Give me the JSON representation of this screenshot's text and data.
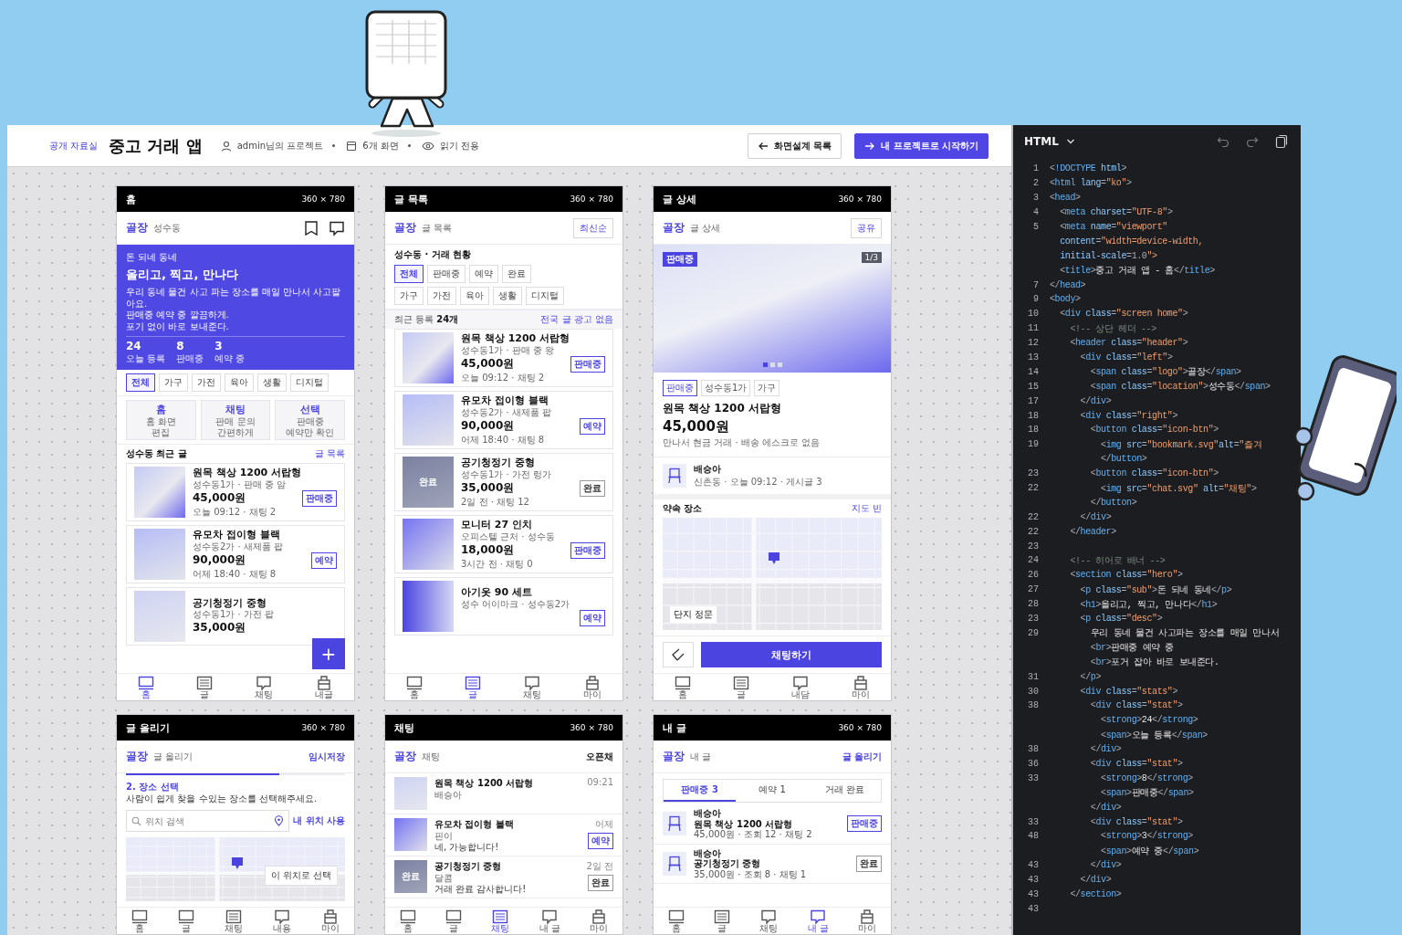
{
  "topbar": {
    "breadcrumb": "공개 자료실",
    "title": "중고 거래 앱",
    "meta": [
      "admin님의 프로젝트",
      "6개 화면",
      "읽기 전용"
    ],
    "buttons": [
      {
        "kind": "secondary",
        "label": "화면설계 목록"
      },
      {
        "kind": "primary",
        "label": "내 프로젝트로 시작하기"
      }
    ]
  },
  "screens": [
    {
      "title": "홈",
      "size": "360 × 780",
      "header": {
        "logo": "골장",
        "subtitle": "성수동",
        "actions": [
          {
            "kind": "bookmark"
          },
          {
            "kind": "chat"
          }
        ]
      },
      "sections": [
        {
          "kind": "hero",
          "eyebrow": "돈 되네 동네",
          "title": "올리고, 찍고, 만나다",
          "desc": [
            "우리 동네 물건 사고 파는 장소를 매일 만나서 사고팔아요.",
            "판매중 예약 중 깔끔하게.",
            "포기 없이 바로 보내준다."
          ],
          "stats": [
            {
              "value": "24",
              "label": "오늘 등록"
            },
            {
              "value": "8",
              "label": "판매중"
            },
            {
              "value": "3",
              "label": "예약 중"
            }
          ]
        },
        {
          "kind": "chips",
          "rows": [
            [
              {
                "label": "전체",
                "selected": true
              },
              {
                "label": "가구",
                "selected": false
              },
              {
                "label": "가전",
                "selected": false
              },
              {
                "label": "육아",
                "selected": false
              },
              {
                "label": "생활",
                "selected": false
              },
              {
                "label": "디지털",
                "selected": false
              }
            ]
          ]
        },
        {
          "kind": "shortcuts",
          "items": [
            {
              "title": "홈",
              "lines": [
                "홈 화면",
                "편집"
              ]
            },
            {
              "title": "채팅",
              "lines": [
                "판매 문의",
                "간편하게"
              ]
            },
            {
              "title": "선택",
              "lines": [
                "판매중",
                "예약만 확인"
              ]
            }
          ]
        },
        {
          "kind": "heading",
          "title": "성수동 최근 글",
          "link": "글 목록"
        },
        {
          "kind": "listings",
          "items": [
            {
              "title": "원목 책상 1200 서랍형",
              "meta": "성수동1가 · 판매 중 암",
              "price": "45,000원",
              "time": "오늘 09:12 · 채팅 2",
              "badge": {
                "label": "판매중",
                "kind": "sale"
              }
            },
            {
              "title": "유모차 접이형 블랙",
              "meta": "성수동2가 · 새제품 팝",
              "price": "90,000원",
              "time": "어제 18:40 · 채팅 8",
              "badge": {
                "label": "예약",
                "kind": "reserved"
              }
            },
            {
              "title": "공기청정기 중형",
              "meta": "성수동1가 · 가전 팝",
              "price": "35,000원"
            }
          ]
        }
      ],
      "fab": "+",
      "nav": [
        {
          "label": "홈",
          "kind": "monitor",
          "selected": true
        },
        {
          "label": "글",
          "kind": "list",
          "selected": false
        },
        {
          "label": "채팅",
          "kind": "chat",
          "selected": false
        },
        {
          "label": "내글",
          "kind": "bag",
          "selected": false
        }
      ]
    },
    {
      "title": "글 목록",
      "size": "360 × 780",
      "header": {
        "logo": "골장",
        "subtitle": "글 목록",
        "actions": [
          {
            "kind": "button",
            "label": "최신순"
          }
        ]
      },
      "sections": [
        {
          "kind": "chips",
          "title": "성수동 · 거래 현황",
          "rows": [
            [
              {
                "label": "전체",
                "selected": true
              },
              {
                "label": "판매중",
                "selected": false
              },
              {
                "label": "예약",
                "selected": false
              },
              {
                "label": "완료",
                "selected": false
              }
            ],
            [
              {
                "label": "가구",
                "selected": false
              },
              {
                "label": "가전",
                "selected": false
              },
              {
                "label": "육아",
                "selected": false
              },
              {
                "label": "생활",
                "selected": false
              },
              {
                "label": "디지털",
                "selected": false
              }
            ]
          ]
        },
        {
          "kind": "count",
          "text": "최근 등록 **24개**",
          "link": "전국 글 광고 없음"
        },
        {
          "kind": "listings",
          "items": [
            {
              "title": "원목 책상 1200 서랍형",
              "meta": "성수동1가 · 판매 중 왕",
              "price": "45,000원",
              "time": "오늘 09:12 · 채팅 2",
              "badge": {
                "label": "판매중",
                "kind": "sale"
              }
            },
            {
              "title": "유모차 접이형 블랙",
              "meta": "성수동2가 · 새제품 팝",
              "price": "90,000원",
              "time": "어제 18:40 · 채팅 8",
              "badge": {
                "label": "예약",
                "kind": "reserved"
              }
            },
            {
              "thumb_label": "완료",
              "title": "공기청정기 중형",
              "meta": "성수동1가 · 가전 렁가",
              "price": "35,000원",
              "time": "2일 전 · 채팅 12",
              "badge": {
                "label": "완료",
                "kind": "done"
              }
            },
            {
              "title": "모니터 27 인치",
              "meta": "오피스텔 근처 · 성수동",
              "price": "18,000원",
              "time": "3시간 전 · 채팅 0",
              "badge": {
                "label": "판매중",
                "kind": "sale"
              }
            },
            {
              "title": "아기옷 90 세트",
              "meta": "성수 어이마크 · 성수동2가",
              "badge": {
                "label": "예약",
                "kind": "reserved"
              }
            }
          ]
        }
      ],
      "nav": [
        {
          "label": "홈",
          "kind": "monitor",
          "selected": false
        },
        {
          "label": "글",
          "kind": "list",
          "selected": true
        },
        {
          "label": "채팅",
          "kind": "chat",
          "selected": false
        },
        {
          "label": "마이",
          "kind": "bag",
          "selected": false
        }
      ]
    },
    {
      "title": "글 상세",
      "size": "360 × 780",
      "header": {
        "logo": "골장",
        "subtitle": "글 상세",
        "actions": [
          {
            "kind": "button",
            "label": "공유"
          }
        ]
      },
      "sections": [
        {
          "kind": "gallery",
          "badge": "판매중",
          "counter": "1/3",
          "pages": [
            {
              "selected": true
            },
            {
              "selected": false
            },
            {
              "selected": false
            }
          ]
        },
        {
          "kind": "detail",
          "tags": [
            {
              "label": "판매중",
              "kind": "status"
            },
            {
              "label": "성수동1가",
              "kind": "plain"
            },
            {
              "label": "가구",
              "kind": "plain"
            }
          ],
          "title": "원목 책상 1200 서랍형",
          "price": "45,000원",
          "note": "만나서 현금 거래 · 배송 에스크로 없음"
        },
        {
          "kind": "seller",
          "name": "배승아",
          "meta": "신촌동 · 오늘 09:12 · 게시글 3"
        },
        {
          "kind": "heading",
          "title": "약속 장소",
          "link": "지도 빈"
        },
        {
          "kind": "map",
          "label": "단지 정문"
        },
        {
          "kind": "cta",
          "label": "채팅하기"
        }
      ],
      "nav": [
        {
          "label": "홈",
          "kind": "monitor",
          "selected": false
        },
        {
          "label": "글",
          "kind": "list",
          "selected": false
        },
        {
          "label": "내담",
          "kind": "chat",
          "selected": false
        },
        {
          "label": "마이",
          "kind": "bag",
          "selected": false
        }
      ]
    },
    {
      "title": "글 올리기",
      "size": "360 × 780",
      "header": {
        "logo": "골장",
        "subtitle": "글 올리기",
        "actions": [
          {
            "kind": "link",
            "label": "임시저장"
          }
        ]
      },
      "sections": [
        {
          "kind": "progress",
          "level": 0.7
        },
        {
          "kind": "step",
          "title": "2. 장소 선택",
          "desc": "사람이 쉽게 찾을 수있는 장소를 선택해주세요."
        },
        {
          "kind": "search",
          "placeholder": "위치 검색",
          "link": "내 위치 사용"
        },
        {
          "kind": "map",
          "button": "이 위치로 선택"
        }
      ],
      "nav": [
        {
          "label": "홈",
          "kind": "monitor",
          "selected": false
        },
        {
          "label": "글",
          "kind": "monitor",
          "selected": false
        },
        {
          "label": "채팅",
          "kind": "list",
          "selected": false
        },
        {
          "label": "내용",
          "kind": "chat",
          "selected": false
        },
        {
          "label": "마이",
          "kind": "bag",
          "selected": false
        }
      ]
    },
    {
      "title": "채팅",
      "size": "360 × 780",
      "header": {
        "logo": "골장",
        "subtitle": "채팅",
        "actions": [
          {
            "kind": "text",
            "label": "오픈채"
          }
        ]
      },
      "sections": [
        {
          "kind": "chats",
          "items": [
            {
              "title": "원목 책상 1200 서랍형",
              "name": "배승아",
              "time": "09:21"
            },
            {
              "title": "유모차 접이형 블랙",
              "name": "핀이",
              "message": "네, 가능합니다!",
              "time": "어제",
              "badge": {
                "label": "예약",
                "kind": "reserved"
              }
            },
            {
              "thumb_label": "완료",
              "title": "공기청정기 중형",
              "name": "달콤",
              "message": "거래 완료 감사합니다!",
              "time": "2일 전",
              "badge": {
                "label": "완료",
                "kind": "done"
              }
            }
          ]
        }
      ],
      "nav": [
        {
          "label": "홈",
          "kind": "monitor",
          "selected": false
        },
        {
          "label": "글",
          "kind": "monitor",
          "selected": false
        },
        {
          "label": "채팅",
          "kind": "list",
          "selected": true
        },
        {
          "label": "내 글",
          "kind": "chat",
          "selected": false
        },
        {
          "label": "마이",
          "kind": "bag",
          "selected": false
        }
      ]
    },
    {
      "title": "내 글",
      "size": "360 × 780",
      "header": {
        "logo": "골장",
        "subtitle": "내 글",
        "actions": [
          {
            "kind": "link",
            "label": "글 올리기"
          }
        ]
      },
      "sections": [
        {
          "kind": "tabs",
          "items": [
            {
              "label": "판매중 3",
              "selected": true
            },
            {
              "label": "예약 1",
              "selected": false
            },
            {
              "label": "거래 완료",
              "selected": false
            }
          ]
        },
        {
          "kind": "myposts",
          "items": [
            {
              "seller": "배승아",
              "title": "원목 책상 1200 서랍형",
              "meta": "45,000원 · 조회 12 · 채팅 2",
              "badge": {
                "label": "판매중",
                "kind": "sale"
              }
            },
            {
              "seller": "배승아",
              "title": "공기청정기 중형",
              "meta": "35,000원 · 조회 8 · 채팅 1",
              "badge": {
                "label": "완료",
                "kind": "done"
              }
            }
          ]
        }
      ],
      "nav": [
        {
          "label": "홈",
          "kind": "monitor",
          "selected": false
        },
        {
          "label": "글",
          "kind": "list",
          "selected": false
        },
        {
          "label": "채팅",
          "kind": "chat",
          "selected": false
        },
        {
          "label": "내 글",
          "kind": "chat",
          "selected": true
        },
        {
          "label": "마이",
          "kind": "bag",
          "selected": false
        }
      ]
    }
  ],
  "code": {
    "language": "HTML",
    "lines": [
      {
        "no": "1",
        "text": "<!DOCTYPE html>"
      },
      {
        "no": "2",
        "text": "<html lang=\"ko\">"
      },
      {
        "no": "3",
        "text": "<head>"
      },
      {
        "no": "4",
        "text": "  <meta charset=\"UTF-8\">"
      },
      {
        "no": "5",
        "text": "  <meta name=\"viewport\""
      },
      {
        "text": "  content=\"width=device-width,"
      },
      {
        "text": "  initial-scale=1.0\">"
      },
      {
        "text": "  <title>중고 거래 앱 - 홈</title>"
      },
      {
        "no": "7",
        "text": "</head>"
      },
      {
        "no": "9",
        "text": "<body>"
      },
      {
        "no": "10",
        "text": "  <div class=\"screen home\">"
      },
      {
        "no": "11",
        "text": "    <!-- 상단 헤더 -->"
      },
      {
        "no": "12",
        "text": "    <header class=\"header\">"
      },
      {
        "no": "13",
        "text": "      <div class=\"left\">"
      },
      {
        "no": "14",
        "text": "        <span class=\"logo\">골장</span>"
      },
      {
        "no": "15",
        "text": "        <span class=\"location\">성수동</span>"
      },
      {
        "no": "17",
        "text": "      </div>"
      },
      {
        "no": "18",
        "text": "      <div class=\"right\">"
      },
      {
        "no": "18",
        "text": "        <button class=\"icon-btn\">"
      },
      {
        "no": "19",
        "text": "          <img src=\"bookmark.svg\"alt=\"즐겨"
      },
      {
        "text": "          </button>"
      },
      {
        "no": "23",
        "text": "        <button class=\"icon-btn\">"
      },
      {
        "no": "22",
        "text": "          <img src=\"chat.svg\" alt=\"채팅\">"
      },
      {
        "text": "        </button>"
      },
      {
        "no": "22",
        "text": "      </div>"
      },
      {
        "no": "22",
        "text": "    </header>"
      },
      {
        "no": "23"
      },
      {
        "no": "24",
        "text": "    <!-- 히어로 배너 -->"
      },
      {
        "no": "26",
        "text": "    <section class=\"hero\">"
      },
      {
        "no": "27",
        "text": "      <p class=\"sub\">돈 되네 동네</p>"
      },
      {
        "no": "28",
        "text": "      <h1>올리고, 찍고, 만나다</h1>"
      },
      {
        "no": "23",
        "text": "      <p class=\"desc\">"
      },
      {
        "no": "29",
        "text": "        우리 동네 물건 사고파는 장소를 매일 만나서"
      },
      {
        "text": "        <br>판매중 예약 중"
      },
      {
        "text": "        <br>포거 잡아 바로 보내준다."
      },
      {
        "no": "31",
        "text": "      </p>"
      },
      {
        "no": "30",
        "text": "      <div class=\"stats\">"
      },
      {
        "no": "38",
        "text": "        <div class=\"stat\">"
      },
      {
        "text": "          <strong>24</strong>"
      },
      {
        "text": "          <span>오늘 등록</span>"
      },
      {
        "no": "38",
        "text": "        </div>"
      },
      {
        "no": "36",
        "text": "        <div class=\"stat\">"
      },
      {
        "no": "33",
        "text": "          <strong>8</strong>"
      },
      {
        "text": "          <span>판매중</span>"
      },
      {
        "text": "        </div>"
      },
      {
        "no": "33",
        "text": "        <div class=\"stat\">"
      },
      {
        "no": "48",
        "text": "          <strong>3</strong>"
      },
      {
        "text": "          <span>예약 중</span>"
      },
      {
        "no": "43",
        "text": "        </div>"
      },
      {
        "no": "43",
        "text": "      </div>"
      },
      {
        "no": "43",
        "text": "    </section>"
      },
      {
        "no": "43"
      }
    ]
  }
}
